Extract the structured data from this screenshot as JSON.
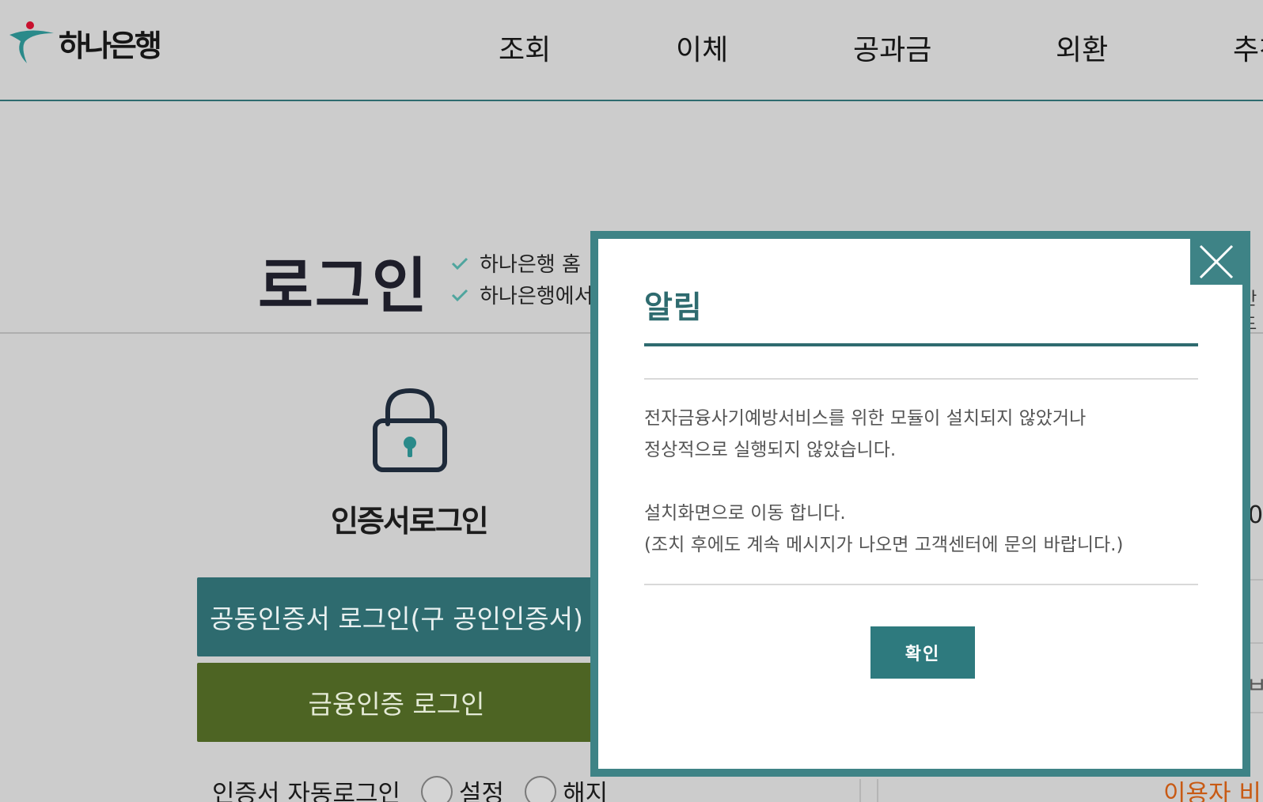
{
  "header": {
    "logo_text": "하나은행",
    "nav": [
      "조회",
      "이체",
      "공과금",
      "외환",
      "추천"
    ]
  },
  "login": {
    "title": "로그인",
    "notice_1": "하나은행 홈",
    "notice_2": "하나은행에서",
    "right_fragment": "안드"
  },
  "cert": {
    "title": "인증서로그인",
    "cert_button": "공동인증서 로그인(구 공인인증서)",
    "fin_button": "금융인증 로그인",
    "auto_label": "인증서 자동로그인",
    "option_set": "설정",
    "option_cancel": "해지"
  },
  "right_panel": {
    "zero_fragment": "0",
    "half_fragment": "ㅂ",
    "orange_text": "이용자 비"
  },
  "modal": {
    "title": "알림",
    "message_line_1": "전자금융사기예방서비스를 위한 모듈이 설치되지 않았거나",
    "message_line_2": "정상적으로 실행되지 않았습니다.",
    "message_line_3": "설치화면으로 이동 합니다.",
    "message_line_4": "(조치 후에도 계속 메시지가 나오면 고객센터에 문의 바랍니다.)",
    "ok_label": "확인",
    "close_icon": "close-icon"
  },
  "colors": {
    "brand_teal": "#2e6b6f",
    "modal_frame": "#3e8386",
    "fin_green": "#4d6423",
    "logo_red": "#c8102e",
    "accent_orange": "#c85a14"
  }
}
